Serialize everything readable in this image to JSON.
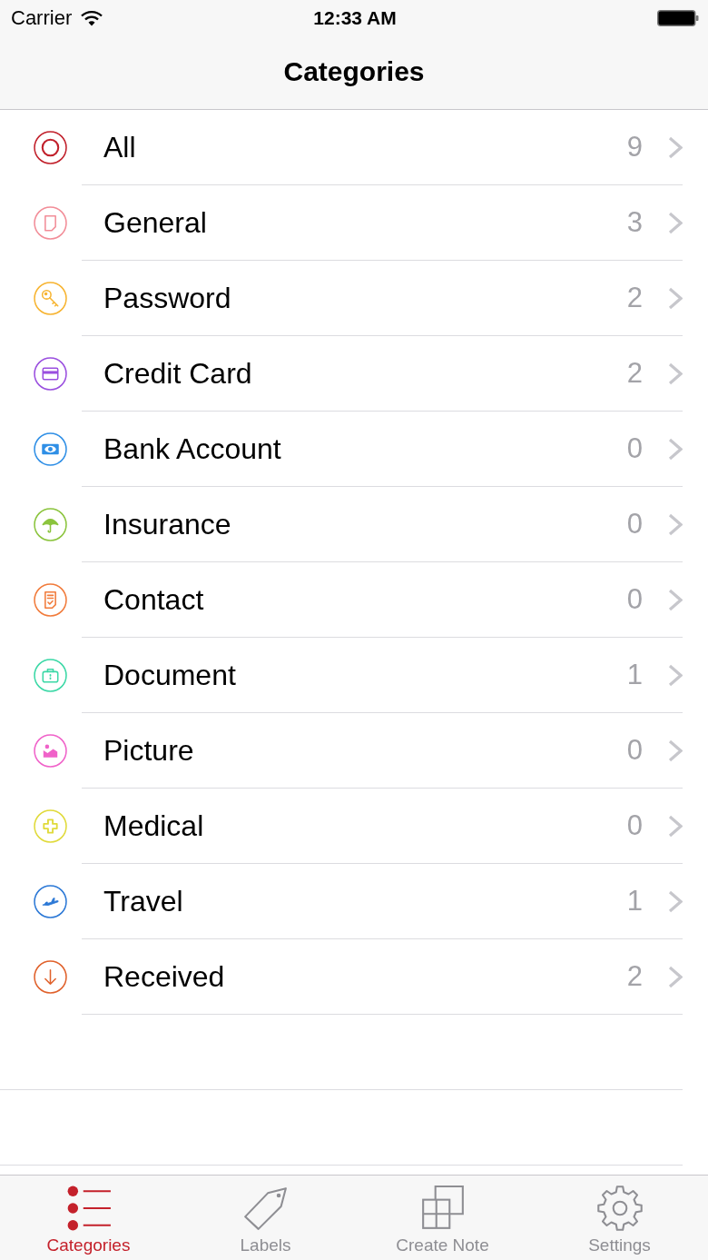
{
  "status_bar": {
    "carrier": "Carrier",
    "time": "12:33 AM"
  },
  "navigation_bar": {
    "title": "Categories"
  },
  "categories": [
    {
      "name": "All",
      "count": "9",
      "color": "#c1202b"
    },
    {
      "name": "General",
      "count": "3",
      "color": "#f28d98"
    },
    {
      "name": "Password",
      "count": "2",
      "color": "#f7b431"
    },
    {
      "name": "Credit Card",
      "count": "2",
      "color": "#9a4fdf"
    },
    {
      "name": "Bank Account",
      "count": "0",
      "color": "#2f8fe6"
    },
    {
      "name": "Insurance",
      "count": "0",
      "color": "#8bc43d"
    },
    {
      "name": "Contact",
      "count": "0",
      "color": "#f17b3b"
    },
    {
      "name": "Document",
      "count": "1",
      "color": "#3bd8a6"
    },
    {
      "name": "Picture",
      "count": "0",
      "color": "#f062c9"
    },
    {
      "name": "Medical",
      "count": "0",
      "color": "#e0da3a"
    },
    {
      "name": "Travel",
      "count": "1",
      "color": "#2b78d6"
    },
    {
      "name": "Received",
      "count": "2",
      "color": "#e0612b"
    }
  ],
  "tab_bar": {
    "tabs": [
      {
        "label": "Categories",
        "selected": true
      },
      {
        "label": "Labels",
        "selected": false
      },
      {
        "label": "Create Note",
        "selected": false
      },
      {
        "label": "Settings",
        "selected": false
      }
    ]
  }
}
